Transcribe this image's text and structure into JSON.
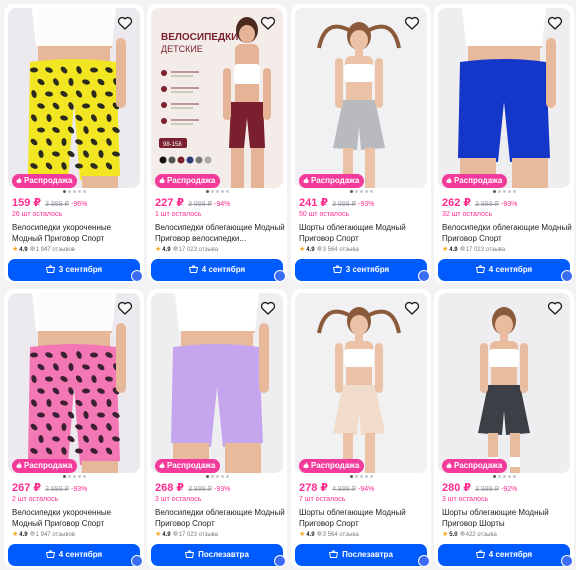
{
  "products": [
    {
      "price": "159 ₽",
      "old_price": "3 999 ₽",
      "discount": "-96%",
      "stock": "26 шт осталось",
      "title": "Велосипедки укороченные Модный Приговор Спорт",
      "rating": "4.9",
      "reviews": "1 947 отзывов",
      "badge": "Распродажа",
      "delivery": "3 сентября",
      "favorite_icon": "heart-outline-icon",
      "cart_icon": "basket-icon",
      "colors": {
        "bg": "#eceaee",
        "skin": "#e7b79a",
        "top": "#ffffff",
        "garment": "#f2e622",
        "pattern": "#2b2a1f"
      }
    },
    {
      "price": "227 ₽",
      "old_price": "3 999 ₽",
      "discount": "-94%",
      "stock": "1 шт осталось",
      "title": "Велосипедки облегающие Модный Приговор велосипедки...",
      "rating": "4.9",
      "reviews": "17 023 отзыва",
      "badge": "Распродажа",
      "delivery": "4 сентября",
      "promo_title": "ВЕЛОСИПЕДКИ",
      "promo_subtitle": "ДЕТСКИЕ",
      "promo_size": "98-158",
      "favorite_icon": "heart-outline-icon",
      "cart_icon": "basket-icon",
      "colors": {
        "bg": "#f3ece8",
        "skin": "#e5b497",
        "top": "#ffffff",
        "garment": "#7a1f2e",
        "pattern": "#7a1f2e"
      }
    },
    {
      "price": "241 ₽",
      "old_price": "3 999 ₽",
      "discount": "-93%",
      "stock": "50 шт осталось",
      "title": "Шорты облегающие Модный Приговор Спорт",
      "rating": "4.9",
      "reviews": "3 564 отзыва",
      "badge": "Распродажа",
      "delivery": "3 сентября",
      "favorite_icon": "heart-outline-icon",
      "cart_icon": "basket-icon",
      "colors": {
        "bg": "#f1f1f3",
        "skin": "#ecc2a6",
        "top": "#ffffff",
        "garment": "#b9b9c0",
        "pattern": "#b9b9c0"
      }
    },
    {
      "price": "262 ₽",
      "old_price": "3 999 ₽",
      "discount": "-93%",
      "stock": "32 шт осталось",
      "title": "Велосипедки облегающие Модный Приговор Спорт",
      "rating": "4.9",
      "reviews": "17 023 отзыва",
      "badge": "Распродажа",
      "delivery": "4 сентября",
      "favorite_icon": "heart-outline-icon",
      "cart_icon": "basket-icon",
      "colors": {
        "bg": "#eeeef0",
        "skin": "#e9b99b",
        "top": "#ffffff",
        "garment": "#1537c9",
        "pattern": "#1537c9"
      }
    },
    {
      "price": "267 ₽",
      "old_price": "3 999 ₽",
      "discount": "-93%",
      "stock": "2 шт осталось",
      "title": "Велосипедки укороченные Модный Приговор Спорт",
      "rating": "4.9",
      "reviews": "1 947 отзывов",
      "badge": "Распродажа",
      "delivery": "4 сентября",
      "favorite_icon": "heart-outline-icon",
      "cart_icon": "basket-icon",
      "colors": {
        "bg": "#eceaee",
        "skin": "#e7b79a",
        "top": "#ffffff",
        "garment": "#f277b4",
        "pattern": "#3a2030"
      }
    },
    {
      "price": "268 ₽",
      "old_price": "3 999 ₽",
      "discount": "-93%",
      "stock": "3 шт осталось",
      "title": "Велосипедки облегающие Модный Приговор Спорт",
      "rating": "4.9",
      "reviews": "17 023 отзыва",
      "badge": "Распродажа",
      "delivery": "Послезавтра",
      "favorite_icon": "heart-outline-icon",
      "cart_icon": "basket-icon",
      "colors": {
        "bg": "#eeeef0",
        "skin": "#e9b99b",
        "top": "#ffffff",
        "garment": "#c4a5ee",
        "pattern": "#c4a5ee"
      }
    },
    {
      "price": "278 ₽",
      "old_price": "4 999 ₽",
      "discount": "-94%",
      "stock": "7 шт осталось",
      "title": "Шорты облегающие Модный Приговор Спорт",
      "rating": "4.9",
      "reviews": "3 564 отзыва",
      "badge": "Распродажа",
      "delivery": "Послезавтра",
      "favorite_icon": "heart-outline-icon",
      "cart_icon": "basket-icon",
      "colors": {
        "bg": "#f1f1f3",
        "skin": "#ecc2a6",
        "top": "#ffffff",
        "garment": "#f1dccb",
        "pattern": "#f1dccb"
      }
    },
    {
      "price": "280 ₽",
      "old_price": "3 999 ₽",
      "discount": "-92%",
      "stock": "3 шт осталось",
      "title": "Шорты облегающие Модный Приговор Шорты",
      "rating": "5.0",
      "reviews": "422 отзыва",
      "badge": "Распродажа",
      "delivery": "4 сентября",
      "favorite_icon": "heart-outline-icon",
      "cart_icon": "basket-icon",
      "colors": {
        "bg": "#eeeef0",
        "skin": "#e8bc9f",
        "top": "#ffffff",
        "garment": "#3c4046",
        "pattern": "#6b7078"
      }
    }
  ],
  "accent_color": "#005bff",
  "sale_color": "#ff2d8f"
}
